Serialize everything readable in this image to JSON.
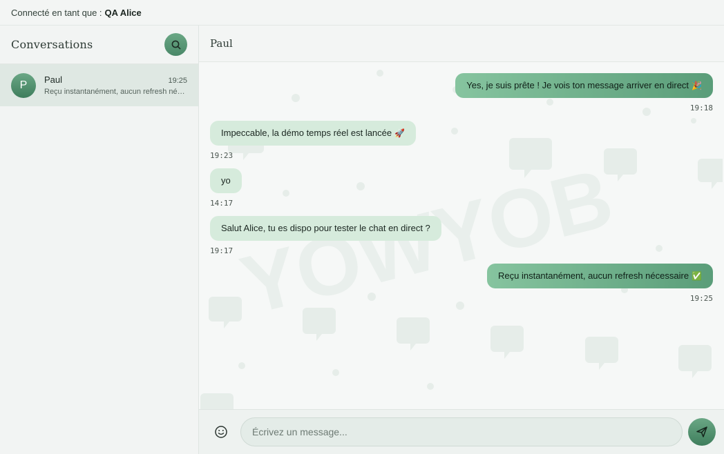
{
  "topbar": {
    "prefix": "Connecté en tant que :",
    "user": "QA Alice"
  },
  "sidebar": {
    "title": "Conversations",
    "search_icon": "search-icon",
    "conversations": [
      {
        "initial": "P",
        "name": "Paul",
        "time": "19:25",
        "preview": "Reçu instantanément, aucun refresh nécessaire ✅"
      }
    ]
  },
  "chat": {
    "title": "Paul",
    "watermark": "YOWYOB",
    "messages": [
      {
        "direction": "out",
        "text": "Yes, je suis prête ! Je vois ton message arriver en direct",
        "emoji": "🎉",
        "time": "19:18"
      },
      {
        "direction": "in",
        "text": "Impeccable, la démo temps réel est lancée",
        "emoji": "🚀",
        "time": "19:23"
      },
      {
        "direction": "in",
        "text": "yo",
        "emoji": "",
        "time": "14:17"
      },
      {
        "direction": "in",
        "text": "Salut Alice, tu es dispo pour tester le chat en direct ?",
        "emoji": "",
        "time": "19:17"
      },
      {
        "direction": "out",
        "text": "Reçu instantanément, aucun refresh nécessaire",
        "emoji": "✅",
        "time": "19:25"
      }
    ]
  },
  "composer": {
    "placeholder": "Écrivez un message...",
    "emoji_icon": "smiley-icon",
    "send_icon": "paper-plane-icon"
  },
  "colors": {
    "accent": "#5a9d79",
    "incoming_bubble": "#d6ebdc",
    "selected_item": "#dfe8e3"
  }
}
